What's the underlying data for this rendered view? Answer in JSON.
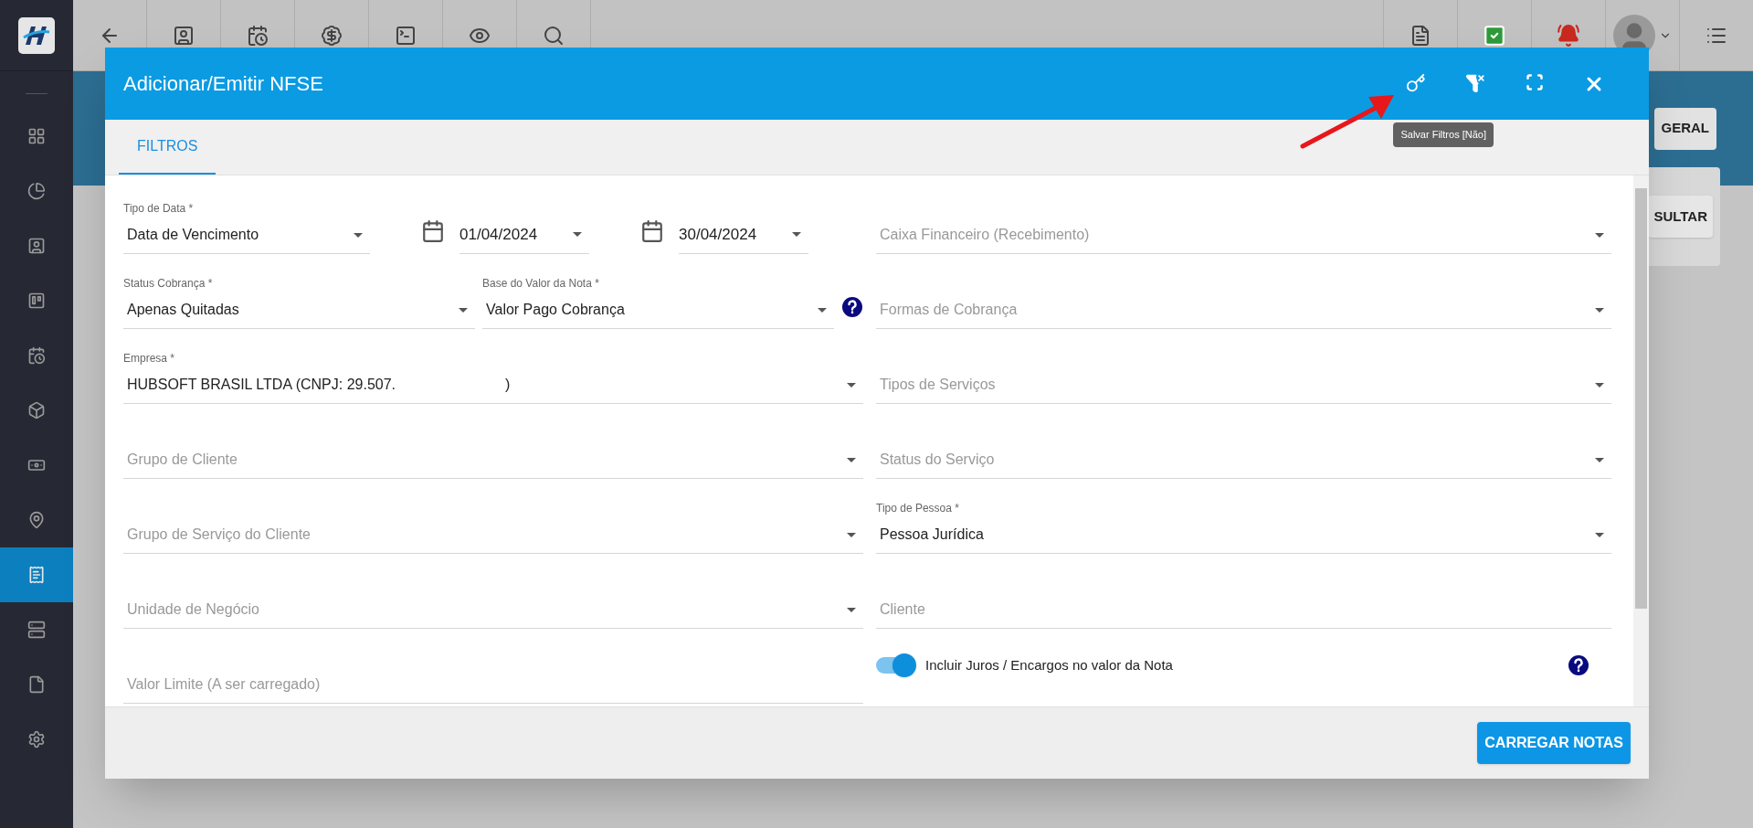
{
  "sidebar": {
    "items": [
      {
        "selected": false
      },
      {
        "selected": false
      },
      {
        "selected": false
      },
      {
        "selected": false
      },
      {
        "selected": false
      },
      {
        "selected": false
      },
      {
        "selected": false
      },
      {
        "selected": false
      },
      {
        "selected": true
      },
      {
        "selected": false
      },
      {
        "selected": false
      },
      {
        "selected": false
      }
    ]
  },
  "background": {
    "buttons": [
      "GERAL",
      "SULTAR"
    ]
  },
  "dialog": {
    "title": "Adicionar/Emitir NFSE",
    "tooltip": "Salvar Filtros [Não]",
    "tabs": [
      {
        "label": "FILTROS",
        "selected": true
      }
    ],
    "left_fields": [
      {
        "kind": "row1"
      },
      {
        "kind": "pair"
      },
      {
        "kind": "select",
        "label": "Empresa *",
        "value": "HUBSOFT BRASIL LTDA (CNPJ: 29.507.",
        "value_end": ")"
      },
      {
        "kind": "select",
        "placeholder": "Grupo de Cliente"
      },
      {
        "kind": "select",
        "placeholder": "Grupo de Serviço do Cliente"
      },
      {
        "kind": "select",
        "placeholder": "Unidade de Negócio"
      },
      {
        "kind": "text",
        "placeholder": "Valor Limite (A ser carregado)"
      }
    ],
    "row1": {
      "date_type": {
        "label": "Tipo de Data *",
        "value": "Data de Vencimento"
      },
      "dates": [
        "01/04/2024",
        "30/04/2024"
      ]
    },
    "pair": [
      {
        "label": "Status Cobrança *",
        "value": "Apenas Quitadas"
      },
      {
        "label": "Base do Valor da Nota *",
        "value": "Valor Pago Cobrança",
        "help": true
      }
    ],
    "right_fields": [
      {
        "kind": "select",
        "placeholder": "Caixa Financeiro (Recebimento)"
      },
      {
        "kind": "select",
        "placeholder": "Formas de Cobrança"
      },
      {
        "kind": "select",
        "placeholder": "Tipos de Serviços"
      },
      {
        "kind": "select",
        "placeholder": "Status do Serviço"
      },
      {
        "kind": "select",
        "label": "Tipo de Pessoa *",
        "value": "Pessoa Jurídica"
      },
      {
        "kind": "text",
        "placeholder": "Cliente"
      },
      {
        "kind": "toggle",
        "label": "Incluir Juros / Encargos no valor da Nota",
        "on": true,
        "help": true
      }
    ],
    "action": "CARREGAR NOTAS"
  }
}
